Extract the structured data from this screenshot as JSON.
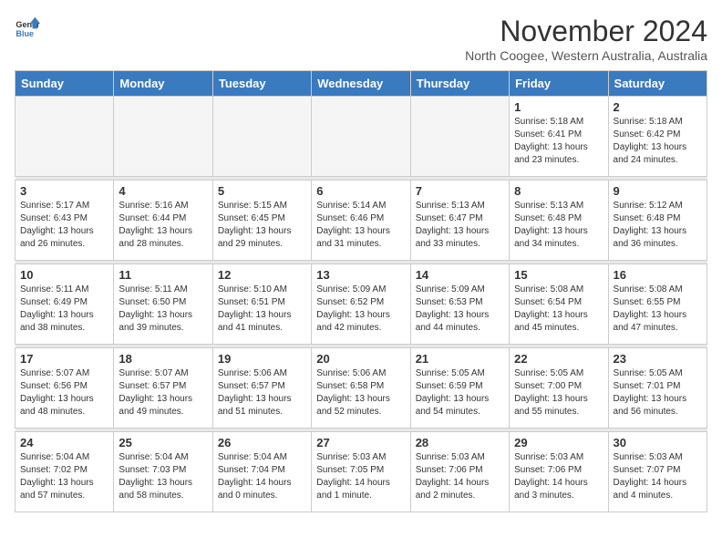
{
  "logo": {
    "text_general": "General",
    "text_blue": "Blue"
  },
  "title": {
    "month": "November 2024",
    "location": "North Coogee, Western Australia, Australia"
  },
  "weekdays": [
    "Sunday",
    "Monday",
    "Tuesday",
    "Wednesday",
    "Thursday",
    "Friday",
    "Saturday"
  ],
  "weeks": [
    [
      {
        "day": "",
        "empty": true
      },
      {
        "day": "",
        "empty": true
      },
      {
        "day": "",
        "empty": true
      },
      {
        "day": "",
        "empty": true
      },
      {
        "day": "",
        "empty": true
      },
      {
        "day": "1",
        "sunrise": "5:18 AM",
        "sunset": "6:41 PM",
        "daylight": "13 hours and 23 minutes."
      },
      {
        "day": "2",
        "sunrise": "5:18 AM",
        "sunset": "6:42 PM",
        "daylight": "13 hours and 24 minutes."
      }
    ],
    [
      {
        "day": "3",
        "sunrise": "5:17 AM",
        "sunset": "6:43 PM",
        "daylight": "13 hours and 26 minutes."
      },
      {
        "day": "4",
        "sunrise": "5:16 AM",
        "sunset": "6:44 PM",
        "daylight": "13 hours and 28 minutes."
      },
      {
        "day": "5",
        "sunrise": "5:15 AM",
        "sunset": "6:45 PM",
        "daylight": "13 hours and 29 minutes."
      },
      {
        "day": "6",
        "sunrise": "5:14 AM",
        "sunset": "6:46 PM",
        "daylight": "13 hours and 31 minutes."
      },
      {
        "day": "7",
        "sunrise": "5:13 AM",
        "sunset": "6:47 PM",
        "daylight": "13 hours and 33 minutes."
      },
      {
        "day": "8",
        "sunrise": "5:13 AM",
        "sunset": "6:48 PM",
        "daylight": "13 hours and 34 minutes."
      },
      {
        "day": "9",
        "sunrise": "5:12 AM",
        "sunset": "6:48 PM",
        "daylight": "13 hours and 36 minutes."
      }
    ],
    [
      {
        "day": "10",
        "sunrise": "5:11 AM",
        "sunset": "6:49 PM",
        "daylight": "13 hours and 38 minutes."
      },
      {
        "day": "11",
        "sunrise": "5:11 AM",
        "sunset": "6:50 PM",
        "daylight": "13 hours and 39 minutes."
      },
      {
        "day": "12",
        "sunrise": "5:10 AM",
        "sunset": "6:51 PM",
        "daylight": "13 hours and 41 minutes."
      },
      {
        "day": "13",
        "sunrise": "5:09 AM",
        "sunset": "6:52 PM",
        "daylight": "13 hours and 42 minutes."
      },
      {
        "day": "14",
        "sunrise": "5:09 AM",
        "sunset": "6:53 PM",
        "daylight": "13 hours and 44 minutes."
      },
      {
        "day": "15",
        "sunrise": "5:08 AM",
        "sunset": "6:54 PM",
        "daylight": "13 hours and 45 minutes."
      },
      {
        "day": "16",
        "sunrise": "5:08 AM",
        "sunset": "6:55 PM",
        "daylight": "13 hours and 47 minutes."
      }
    ],
    [
      {
        "day": "17",
        "sunrise": "5:07 AM",
        "sunset": "6:56 PM",
        "daylight": "13 hours and 48 minutes."
      },
      {
        "day": "18",
        "sunrise": "5:07 AM",
        "sunset": "6:57 PM",
        "daylight": "13 hours and 49 minutes."
      },
      {
        "day": "19",
        "sunrise": "5:06 AM",
        "sunset": "6:57 PM",
        "daylight": "13 hours and 51 minutes."
      },
      {
        "day": "20",
        "sunrise": "5:06 AM",
        "sunset": "6:58 PM",
        "daylight": "13 hours and 52 minutes."
      },
      {
        "day": "21",
        "sunrise": "5:05 AM",
        "sunset": "6:59 PM",
        "daylight": "13 hours and 54 minutes."
      },
      {
        "day": "22",
        "sunrise": "5:05 AM",
        "sunset": "7:00 PM",
        "daylight": "13 hours and 55 minutes."
      },
      {
        "day": "23",
        "sunrise": "5:05 AM",
        "sunset": "7:01 PM",
        "daylight": "13 hours and 56 minutes."
      }
    ],
    [
      {
        "day": "24",
        "sunrise": "5:04 AM",
        "sunset": "7:02 PM",
        "daylight": "13 hours and 57 minutes."
      },
      {
        "day": "25",
        "sunrise": "5:04 AM",
        "sunset": "7:03 PM",
        "daylight": "13 hours and 58 minutes."
      },
      {
        "day": "26",
        "sunrise": "5:04 AM",
        "sunset": "7:04 PM",
        "daylight": "14 hours and 0 minutes."
      },
      {
        "day": "27",
        "sunrise": "5:03 AM",
        "sunset": "7:05 PM",
        "daylight": "14 hours and 1 minute."
      },
      {
        "day": "28",
        "sunrise": "5:03 AM",
        "sunset": "7:06 PM",
        "daylight": "14 hours and 2 minutes."
      },
      {
        "day": "29",
        "sunrise": "5:03 AM",
        "sunset": "7:06 PM",
        "daylight": "14 hours and 3 minutes."
      },
      {
        "day": "30",
        "sunrise": "5:03 AM",
        "sunset": "7:07 PM",
        "daylight": "14 hours and 4 minutes."
      }
    ]
  ],
  "labels": {
    "sunrise": "Sunrise:",
    "sunset": "Sunset:",
    "daylight": "Daylight:"
  }
}
